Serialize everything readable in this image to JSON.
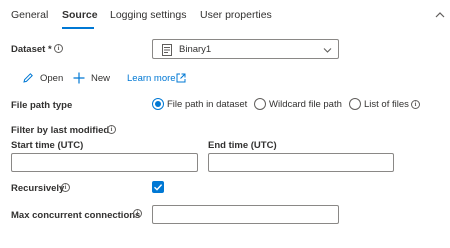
{
  "tabs": [
    {
      "label": "General"
    },
    {
      "label": "Source",
      "active": true
    },
    {
      "label": "Logging settings"
    },
    {
      "label": "User properties"
    }
  ],
  "colors": {
    "accent": "#0078d4",
    "text": "#323130",
    "border": "#8a8886"
  },
  "dataset": {
    "label": "Dataset *",
    "value": "Binary1"
  },
  "actions": {
    "open": "Open",
    "new": "New",
    "learn_more": "Learn more"
  },
  "file_path_type": {
    "label": "File path type",
    "options": [
      "File path in dataset",
      "Wildcard file path",
      "List of files"
    ],
    "selected": "File path in dataset"
  },
  "filter": {
    "label": "Filter by last modified",
    "start_label": "Start time (UTC)",
    "end_label": "End time (UTC)",
    "start_value": "",
    "end_value": ""
  },
  "recursively": {
    "label": "Recursively",
    "checked": true
  },
  "max_connections": {
    "label": "Max concurrent connections",
    "value": ""
  }
}
